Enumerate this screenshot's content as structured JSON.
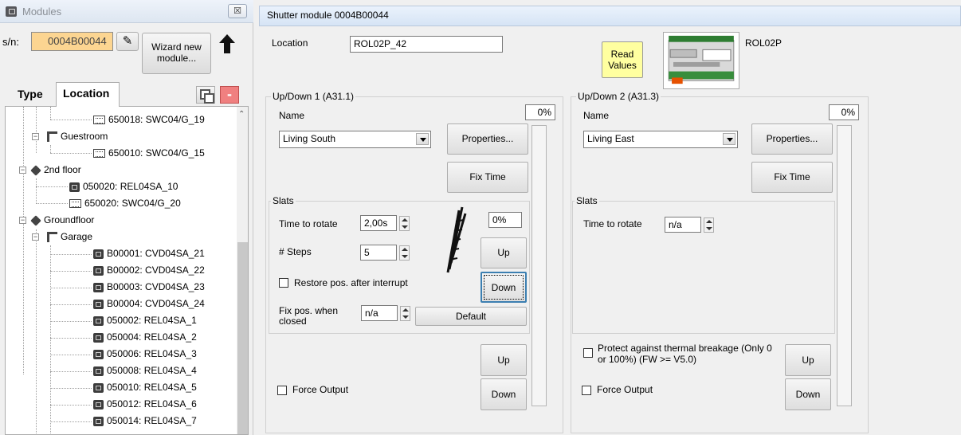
{
  "left_panel": {
    "title": "Modules",
    "close_label": "☒",
    "sn_label": "s/n:",
    "sn_value": "0004B00044",
    "wizard_label_1": "Wizard new",
    "wizard_label_2": "module...",
    "tabs": {
      "type": "Type",
      "location": "Location"
    },
    "tree": [
      {
        "label": "650018: SWC04/G_19",
        "icon": "panel-icon"
      },
      {
        "label": "Guestroom",
        "icon": "room-icon"
      },
      {
        "label": "650010: SWC04/G_15",
        "icon": "panel-icon"
      },
      {
        "label": "2nd floor",
        "icon": "floor-icon"
      },
      {
        "label": "050020: REL04SA_10",
        "icon": "module-icon"
      },
      {
        "label": "650020: SWC04/G_20",
        "icon": "panel-icon"
      },
      {
        "label": "Groundfloor",
        "icon": "floor-icon"
      },
      {
        "label": "Garage",
        "icon": "room-icon"
      },
      {
        "label": "B00001: CVD04SA_21",
        "icon": "module-icon"
      },
      {
        "label": "B00002: CVD04SA_22",
        "icon": "module-icon"
      },
      {
        "label": "B00003: CVD04SA_23",
        "icon": "module-icon"
      },
      {
        "label": "B00004: CVD04SA_24",
        "icon": "module-icon"
      },
      {
        "label": "050002: REL04SA_1",
        "icon": "module-icon"
      },
      {
        "label": "050004: REL04SA_2",
        "icon": "module-icon"
      },
      {
        "label": "050006: REL04SA_3",
        "icon": "module-icon"
      },
      {
        "label": "050008: REL04SA_4",
        "icon": "module-icon"
      },
      {
        "label": "050010: REL04SA_5",
        "icon": "module-icon"
      },
      {
        "label": "050012: REL04SA_6",
        "icon": "module-icon"
      },
      {
        "label": "050014: REL04SA_7",
        "icon": "module-icon"
      }
    ]
  },
  "right_panel": {
    "title": "Shutter module 0004B00044",
    "location_label": "Location",
    "location_value": "ROL02P_42",
    "read_values_1": "Read",
    "read_values_2": "Values",
    "module_type": "ROL02P",
    "channel1": {
      "group_title": "Up/Down 1 (A31.1)",
      "name_label": "Name",
      "name_value": "Living South",
      "percent": "0%",
      "properties_label": "Properties...",
      "fix_time_label": "Fix Time",
      "slats_title": "Slats",
      "time_to_rotate_label": "Time to rotate",
      "time_to_rotate_value": "2,00s",
      "steps_label": "# Steps",
      "steps_value": "5",
      "slat_percent": "0%",
      "up_label": "Up",
      "down_label": "Down",
      "restore_label": "Restore pos. after interrupt",
      "fix_pos_label_1": "Fix pos. when",
      "fix_pos_label_2": "closed",
      "fix_pos_value": "n/a",
      "default_label": "Default",
      "force_output_label": "Force Output",
      "out_up_label": "Up",
      "out_down_label": "Down"
    },
    "channel2": {
      "group_title": "Up/Down 2 (A31.3)",
      "name_label": "Name",
      "name_value": "Living East",
      "percent": "0%",
      "properties_label": "Properties...",
      "fix_time_label": "Fix Time",
      "slats_title": "Slats",
      "time_to_rotate_label": "Time to rotate",
      "time_to_rotate_value": "n/a",
      "protect_label_1": "Protect against thermal breakage (Only 0",
      "protect_label_2": "or 100%) (FW >= V5.0)",
      "force_output_label": "Force Output",
      "out_up_label": "Up",
      "out_down_label": "Down"
    }
  }
}
